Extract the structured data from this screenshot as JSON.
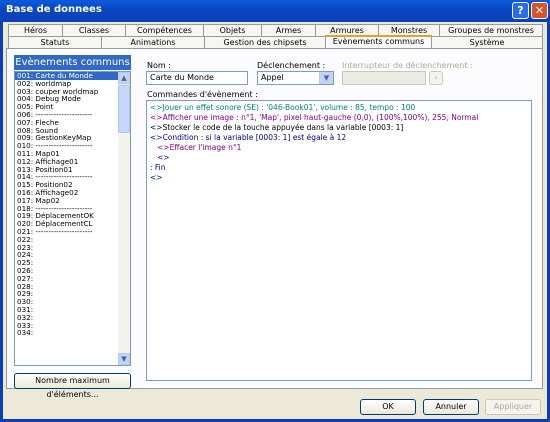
{
  "window": {
    "title": "Base de donnees"
  },
  "tabs_top": [
    "Héros",
    "Classes",
    "Compétences",
    "Objets",
    "Armes",
    "Armures",
    "Monstres",
    "Groupes de monstres"
  ],
  "tabs_bottom": [
    "Statuts",
    "Animations",
    "Gestion des chipsets",
    "Evènements communs",
    "Système"
  ],
  "active_tab": "Evènements communs",
  "list": {
    "header": "Evènements communs",
    "items": [
      "001: Carte du Monde",
      "002: worldmap",
      "003: couper worldmap",
      "004: Debug Mode",
      "005: Point",
      "006: ----------------------",
      "007: Fleche",
      "008: Sound",
      "009: GestionKeyMap",
      "010: ----------------------",
      "011: Map01",
      "012: Affichage01",
      "013: Position01",
      "014: ----------------------",
      "015: Position02",
      "016: Affichage02",
      "017: Map02",
      "018: ----------------------",
      "019: DéplacementOK",
      "020: DéplacementCL",
      "021: ----------------------",
      "022:",
      "023:",
      "024:",
      "025:",
      "026:",
      "027:",
      "028:",
      "029:",
      "030:",
      "031:",
      "032:",
      "033:",
      "034:"
    ],
    "selected_index": 0,
    "max_button": "Nombre maximum d'éléments..."
  },
  "form": {
    "name_label": "Nom :",
    "name_value": "Carte du Monde",
    "trigger_label": "Déclenchement :",
    "trigger_value": "Appel",
    "switch_label": "Interrupteur de déclenchement :",
    "commands_label": "Commandes d'évènement :",
    "commands": [
      {
        "text": "<>Jouer un effet sonore (SE) : '046-Book01', volume : 85, tempo : 100",
        "color": "teal"
      },
      {
        "text": "<>Afficher une image : n°1, 'Map', pixel haut-gauche (0,0), (100%,100%), 255, Normal",
        "color": "purple"
      },
      {
        "text": "<>Stocker le code de la touche appuyée dans la variable [0003: 1]",
        "color": "black"
      },
      {
        "text": "<>Condition : si la variable [0003: 1] est égale à 12",
        "color": "blue"
      },
      {
        "text": "   <>Effacer l'image n°1",
        "color": "purple"
      },
      {
        "text": "   <>",
        "color": "blue"
      },
      {
        "text": " : Fin",
        "color": "blue"
      },
      {
        "text": "<>",
        "color": "blue"
      }
    ]
  },
  "footer": {
    "ok": "OK",
    "cancel": "Annuler",
    "apply": "Appliquer"
  }
}
